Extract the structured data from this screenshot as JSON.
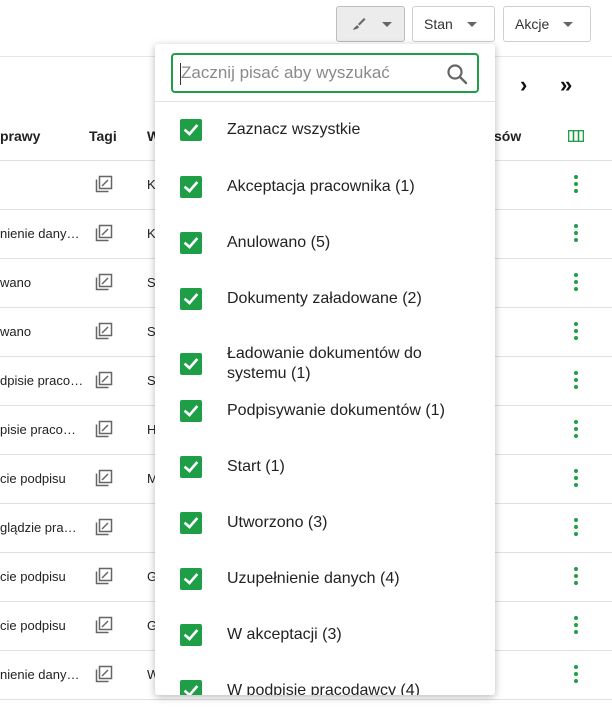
{
  "toolbar": {
    "brush_icon": "brush-icon",
    "stan_label": "Stan",
    "akcje_label": "Akcje"
  },
  "pager": {
    "next": "›",
    "last": "»"
  },
  "table": {
    "headers": [
      "prawy",
      "Tagi",
      "W",
      "sów"
    ],
    "rows": [
      {
        "c1": "",
        "c3": "K"
      },
      {
        "c1": "nienie dany…",
        "c3": "K"
      },
      {
        "c1": "wano",
        "c3": "S"
      },
      {
        "c1": "wano",
        "c3": "S"
      },
      {
        "c1": "dpisie praco…",
        "c3": "S"
      },
      {
        "c1": "pisie praco…",
        "c3": "H"
      },
      {
        "c1": "cie podpisu",
        "c3": "M"
      },
      {
        "c1": "glądzie pra…",
        "c3": ""
      },
      {
        "c1": "cie podpisu",
        "c3": "G"
      },
      {
        "c1": "cie podpisu",
        "c3": "G"
      },
      {
        "c1": "nienie dany…",
        "c3": "W"
      }
    ]
  },
  "dropdown": {
    "search_placeholder": "Zacznij pisać aby wyszukać",
    "options": [
      {
        "label": "Zaznacz wszystkie",
        "checked": true
      },
      {
        "label": "Akceptacja pracownika (1)",
        "checked": true
      },
      {
        "label": "Anulowano (5)",
        "checked": true
      },
      {
        "label": "Dokumenty załadowane (2)",
        "checked": true
      },
      {
        "label": "Ładowanie dokumentów do systemu (1)",
        "checked": true
      },
      {
        "label": "Podpisywanie dokumentów (1)",
        "checked": true
      },
      {
        "label": "Start (1)",
        "checked": true
      },
      {
        "label": "Utworzono (3)",
        "checked": true
      },
      {
        "label": "Uzupełnienie danych (4)",
        "checked": true
      },
      {
        "label": "W akceptacji (3)",
        "checked": true
      },
      {
        "label": "W podpisie pracodawcy (4)",
        "checked": true
      }
    ]
  },
  "colors": {
    "accent": "#1e9e47",
    "border": "#e0e0e0"
  }
}
